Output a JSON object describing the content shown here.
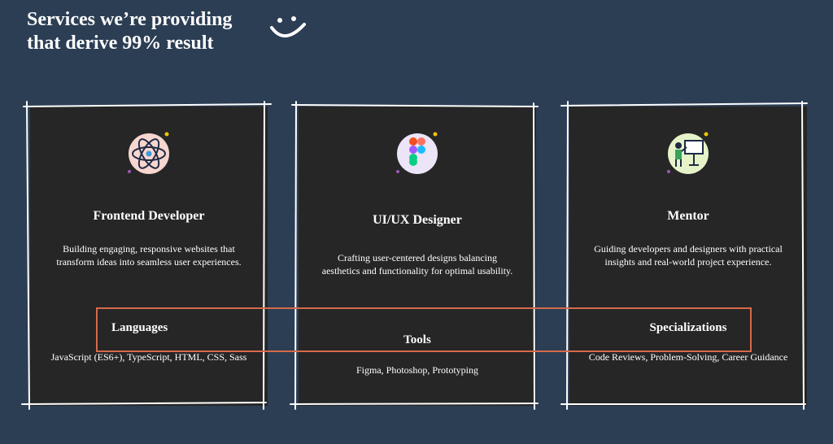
{
  "header": {
    "line1": "Services we’re providing",
    "line2": "that derive 99% result",
    "decoration_icon": "smile-icon"
  },
  "cards": [
    {
      "icon": "react-atom-icon",
      "title": "Frontend Developer",
      "description": "Building engaging, responsive websites that transform ideas into seamless user experiences.",
      "section_heading": "Languages",
      "section_items": "JavaScript (ES6+), TypeScript, HTML, CSS, Sass"
    },
    {
      "icon": "figma-logo-icon",
      "title": "UI/UX Designer",
      "description": "Crafting user-centered designs balancing aesthetics and functionality for optimal usability.",
      "section_heading": "Tools",
      "section_items": "Figma, Photoshop, Prototyping"
    },
    {
      "icon": "presentation-board-icon",
      "title": "Mentor",
      "description": "Guiding developers and designers with practical insights and real-world project experience.",
      "section_heading": "Specializations",
      "section_items": "Code Reviews, Problem-Solving, Career Guidance"
    }
  ],
  "colors": {
    "background": "#2c3e54",
    "card": "#262626",
    "highlight": "#d66a4a"
  }
}
